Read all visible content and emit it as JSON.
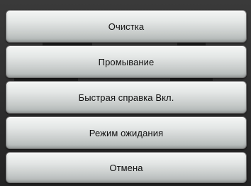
{
  "menu": {
    "items": [
      {
        "label": "Очистка"
      },
      {
        "label": "Промывание"
      },
      {
        "label": "Быстрая справка Вкл."
      },
      {
        "label": "Режим ожидания"
      },
      {
        "label": "Отмена"
      }
    ]
  },
  "colors": {
    "background": "#2b2b2b",
    "button_top": "#f4f6f5",
    "button_bottom": "#aeb3b2",
    "text": "#101010"
  }
}
